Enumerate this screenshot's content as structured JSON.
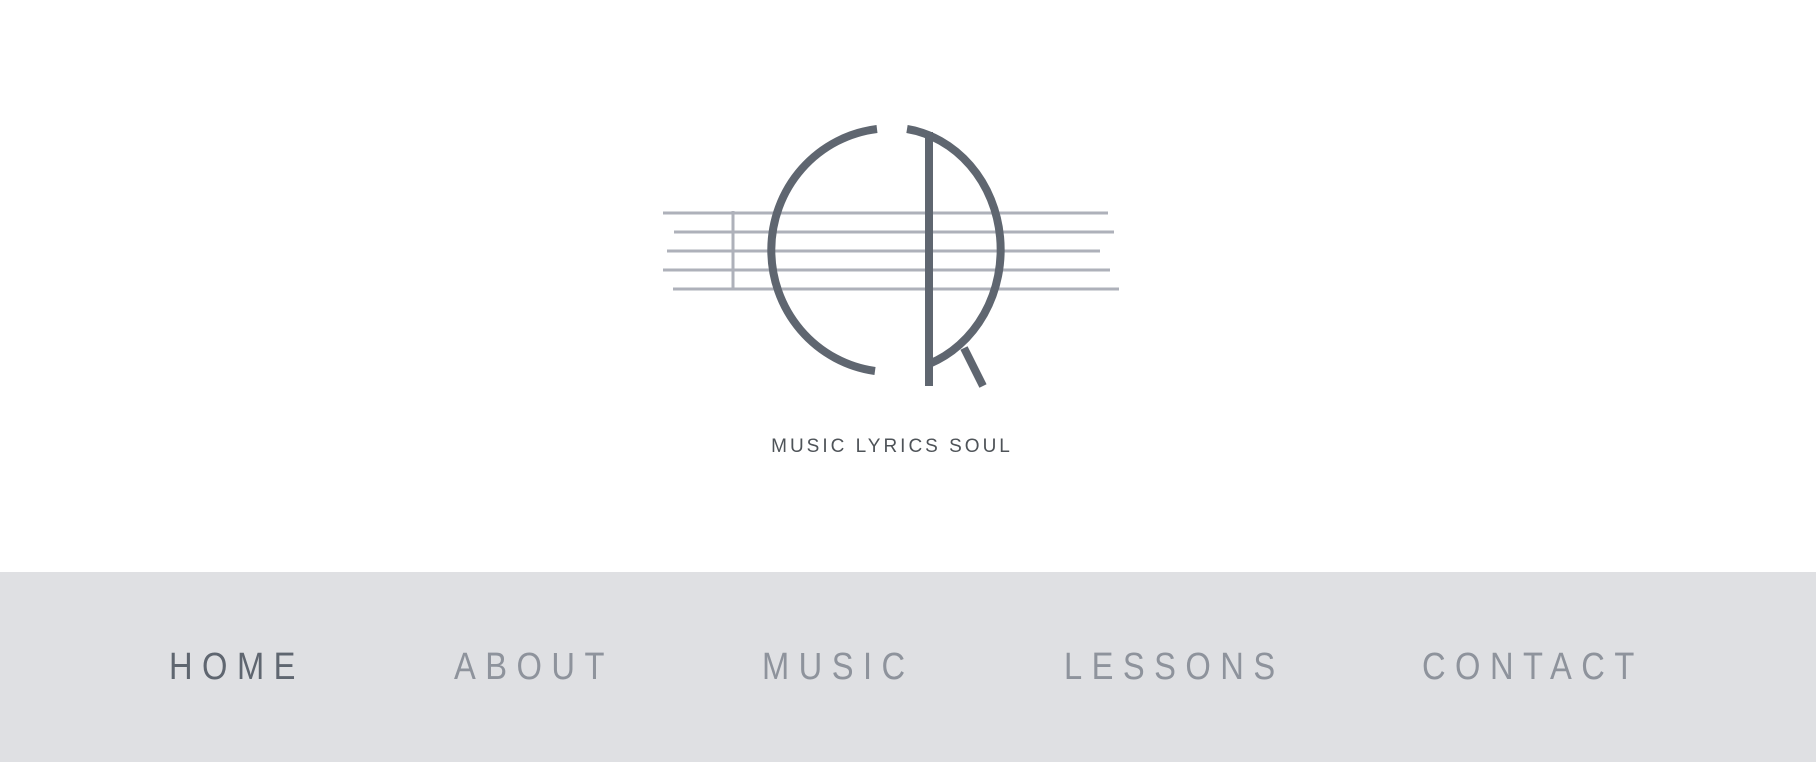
{
  "brand": {
    "logo_name": "CR music monogram",
    "tagline": "MUSIC LYRICS SOUL"
  },
  "nav": {
    "items": [
      {
        "label": "HOME",
        "active": true
      },
      {
        "label": "ABOUT",
        "active": false
      },
      {
        "label": "MUSIC",
        "active": false
      },
      {
        "label": "LESSONS",
        "active": false
      },
      {
        "label": "CONTACT",
        "active": false
      }
    ]
  },
  "colors": {
    "hero_background": "#ffffff",
    "nav_background": "#dfe0e3",
    "logo_dark": "#5f6670",
    "staff_lines": "#aeb1ba",
    "nav_active": "#5f6670",
    "nav_inactive": "#8e939c",
    "tagline": "#4e5358"
  }
}
